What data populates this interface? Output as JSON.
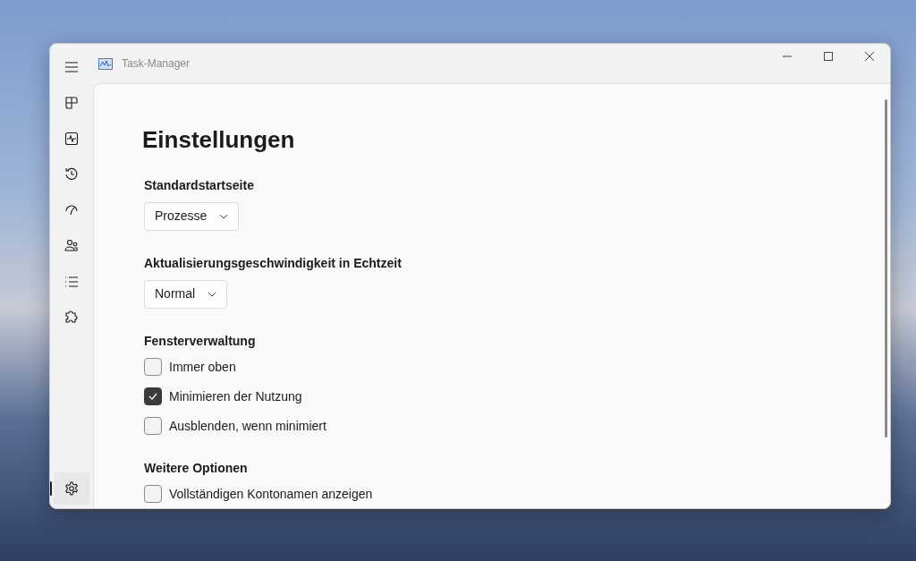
{
  "window": {
    "title": "Task-Manager"
  },
  "nav": [
    {
      "selected": false
    },
    {
      "selected": false
    },
    {
      "selected": false
    },
    {
      "selected": false
    },
    {
      "selected": false
    },
    {
      "selected": false
    },
    {
      "selected": false
    },
    {
      "selected": false
    },
    {
      "selected": true
    }
  ],
  "page_title": "Einstellungen",
  "sections": [
    {
      "kind": "dropdown",
      "heading": "Standardstartseite",
      "value": "Prozesse"
    },
    {
      "kind": "dropdown",
      "heading": "Aktualisierungsgeschwindigkeit in Echtzeit",
      "value": "Normal"
    },
    {
      "kind": "checkboxes",
      "heading": "Fensterverwaltung",
      "options": [
        {
          "label": "Immer oben",
          "checked": false
        },
        {
          "label": "Minimieren der Nutzung",
          "checked": true
        },
        {
          "label": "Ausblenden, wenn minimiert",
          "checked": false
        }
      ]
    },
    {
      "kind": "checkboxes",
      "heading": "Weitere Optionen",
      "options": [
        {
          "label": "Vollständigen Kontonamen anzeigen",
          "checked": false
        }
      ]
    }
  ]
}
